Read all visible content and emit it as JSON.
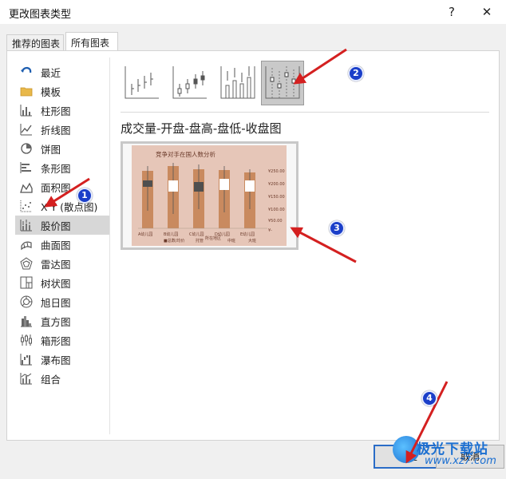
{
  "window": {
    "title": "更改图表类型",
    "help_label": "?",
    "close_label": "✕"
  },
  "tabs": [
    {
      "label": "推荐的图表",
      "active": false
    },
    {
      "label": "所有图表",
      "active": true
    }
  ],
  "sidebar": {
    "items": [
      {
        "label": "最近",
        "icon": "undo-arrow-icon"
      },
      {
        "label": "模板",
        "icon": "folder-icon"
      },
      {
        "label": "柱形图",
        "icon": "column-chart-icon"
      },
      {
        "label": "折线图",
        "icon": "line-chart-icon"
      },
      {
        "label": "饼图",
        "icon": "pie-chart-icon"
      },
      {
        "label": "条形图",
        "icon": "bar-chart-icon"
      },
      {
        "label": "面积图",
        "icon": "area-chart-icon"
      },
      {
        "label": "X Y (散点图)",
        "icon": "scatter-chart-icon"
      },
      {
        "label": "股价图",
        "icon": "stock-chart-icon",
        "selected": true
      },
      {
        "label": "曲面图",
        "icon": "surface-chart-icon"
      },
      {
        "label": "雷达图",
        "icon": "radar-chart-icon"
      },
      {
        "label": "树状图",
        "icon": "treemap-icon"
      },
      {
        "label": "旭日图",
        "icon": "sunburst-icon"
      },
      {
        "label": "直方图",
        "icon": "histogram-icon"
      },
      {
        "label": "箱形图",
        "icon": "box-whisker-icon"
      },
      {
        "label": "瀑布图",
        "icon": "waterfall-icon"
      },
      {
        "label": "组合",
        "icon": "combo-chart-icon"
      }
    ]
  },
  "subtypes": {
    "selected_index": 3,
    "icons": [
      "high-low-close-icon",
      "open-high-low-close-icon",
      "volume-high-low-close-icon",
      "volume-open-high-low-close-icon"
    ]
  },
  "chart_type_name": "成交量-开盘-盘高-盘低-收盘图",
  "preview": {
    "title": "竞争对手在国人数分析",
    "y_ticks": [
      "¥250.00",
      "¥200.00",
      "¥150.00",
      "¥100.00",
      "¥50.00",
      "¥-"
    ],
    "categories": [
      "A幼儿园",
      "B幼儿园",
      "C幼儿园",
      "D幼儿园",
      "E幼儿园"
    ],
    "legend_a": "■总数/均价",
    "legend_b": "托管",
    "legend_c": "中班",
    "legend_d": "大班",
    "xlabel": "所在地区"
  },
  "buttons": {
    "ok": "确定",
    "cancel": "取消"
  },
  "markers": [
    "1",
    "2",
    "3",
    "4"
  ],
  "watermark": {
    "text": "极光下载站",
    "url": "www.xz7.com"
  },
  "colors": {
    "arrow": "#d42020",
    "marker": "#1b3fc9",
    "selected": "#d7d7d7",
    "preview_bg": "#e6c6b8",
    "candle": "#c98a5f"
  }
}
